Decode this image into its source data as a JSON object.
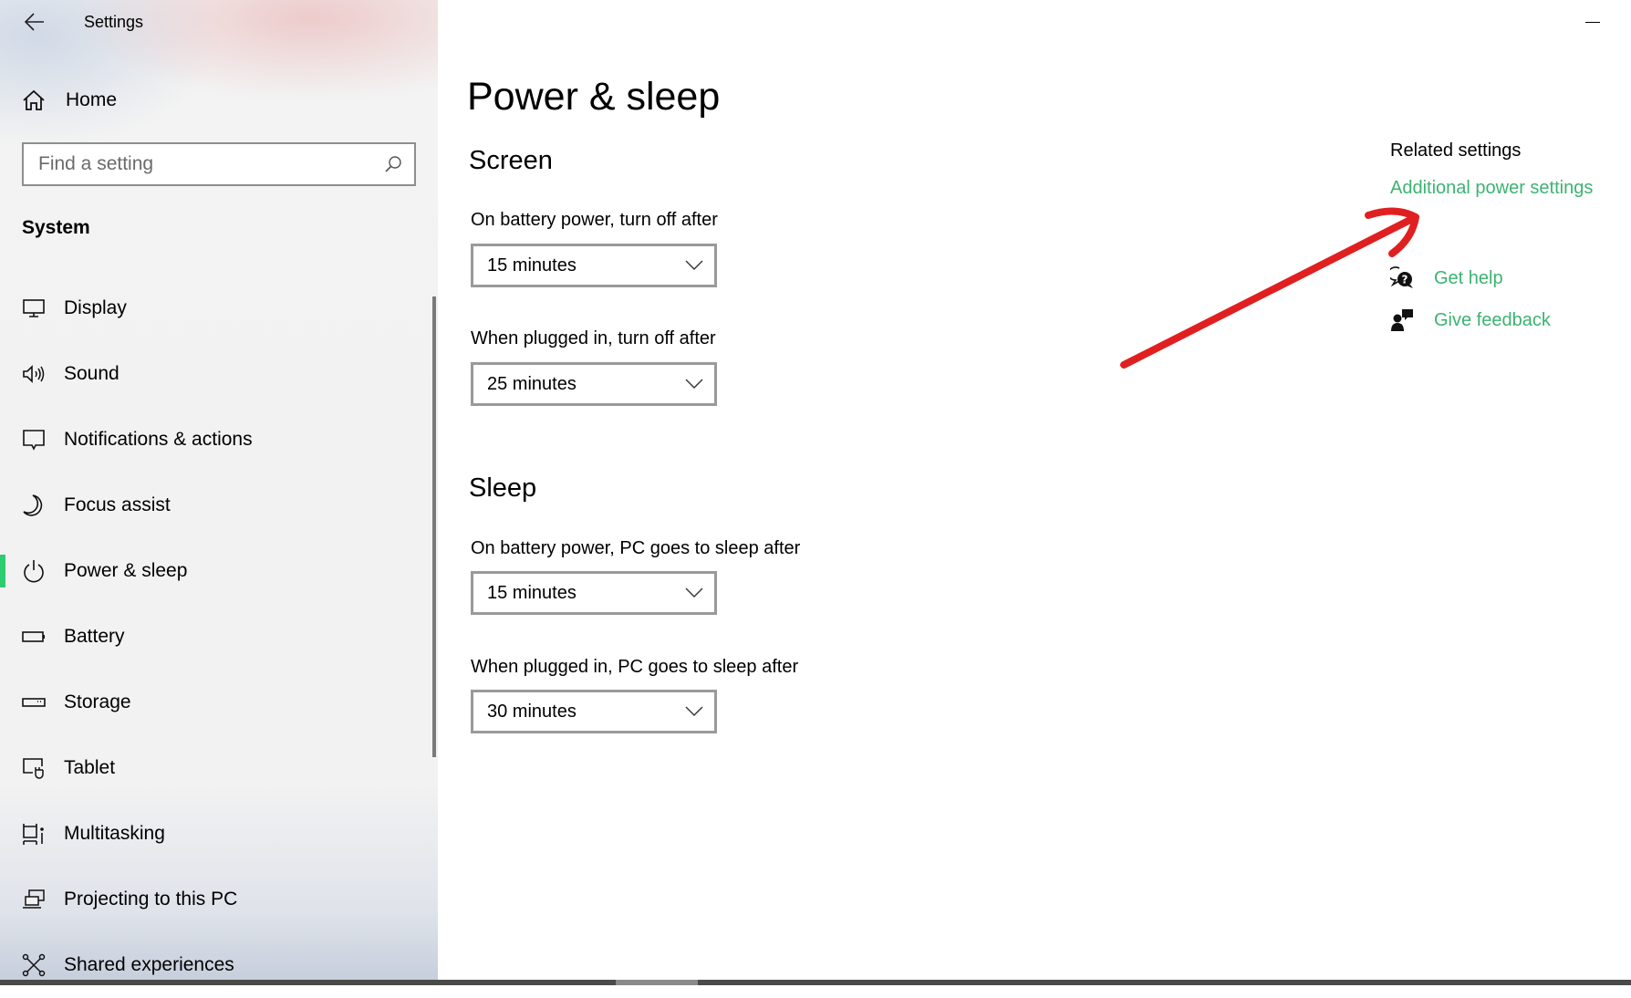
{
  "window": {
    "title": "Settings",
    "back_icon": "arrow-left-icon",
    "minimize_icon": "minimize-icon"
  },
  "sidebar": {
    "home": {
      "label": "Home",
      "icon": "home-icon"
    },
    "search": {
      "placeholder": "Find a setting",
      "value": "",
      "icon": "search-icon"
    },
    "section": "System",
    "accent_color": "#2ecc71",
    "items": [
      {
        "label": "Display",
        "icon": "monitor-icon",
        "selected": false
      },
      {
        "label": "Sound",
        "icon": "speaker-icon",
        "selected": false
      },
      {
        "label": "Notifications & actions",
        "icon": "notification-icon",
        "selected": false
      },
      {
        "label": "Focus assist",
        "icon": "moon-icon",
        "selected": false
      },
      {
        "label": "Power & sleep",
        "icon": "power-icon",
        "selected": true
      },
      {
        "label": "Battery",
        "icon": "battery-icon",
        "selected": false
      },
      {
        "label": "Storage",
        "icon": "storage-icon",
        "selected": false
      },
      {
        "label": "Tablet",
        "icon": "tablet-icon",
        "selected": false
      },
      {
        "label": "Multitasking",
        "icon": "multitasking-icon",
        "selected": false
      },
      {
        "label": "Projecting to this PC",
        "icon": "projecting-icon",
        "selected": false
      },
      {
        "label": "Shared experiences",
        "icon": "shared-experiences-icon",
        "selected": false
      }
    ]
  },
  "main": {
    "title": "Power & sleep",
    "sections": [
      {
        "heading": "Screen",
        "settings": [
          {
            "label": "On battery power, turn off after",
            "value": "15 minutes"
          },
          {
            "label": "When plugged in, turn off after",
            "value": "25 minutes"
          }
        ]
      },
      {
        "heading": "Sleep",
        "settings": [
          {
            "label": "On battery power, PC goes to sleep after",
            "value": "15 minutes"
          },
          {
            "label": "When plugged in, PC goes to sleep after",
            "value": "30 minutes"
          }
        ]
      }
    ]
  },
  "related": {
    "title": "Related settings",
    "link": "Additional power settings",
    "link_color": "#3cb371",
    "help": [
      {
        "label": "Get help",
        "icon": "help-chat-icon"
      },
      {
        "label": "Give feedback",
        "icon": "feedback-icon"
      }
    ]
  },
  "annotation": {
    "type": "red-arrow",
    "points_to": "Additional power settings",
    "color": "#e02020"
  }
}
